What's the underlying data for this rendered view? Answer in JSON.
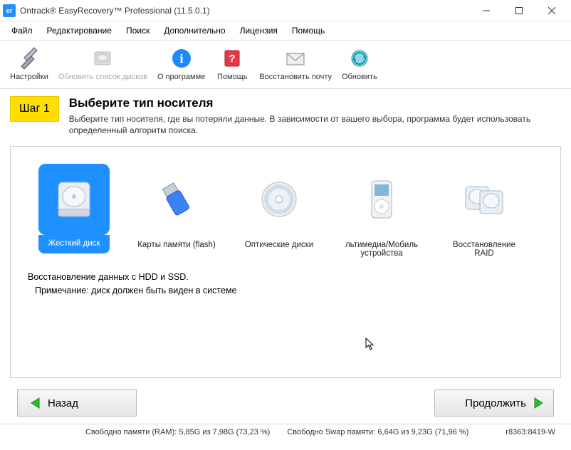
{
  "window": {
    "app_icon_text": "er",
    "title": "Ontrack® EasyRecovery™ Professional (11.5.0.1)"
  },
  "menu": {
    "items": [
      "Файл",
      "Редактирование",
      "Поиск",
      "Дополнительно",
      "Лицензия",
      "Помощь"
    ]
  },
  "toolbar": {
    "settings": "Настройки",
    "refresh_disks": "Обновить список дисков",
    "about": "О программе",
    "help": "Помощь",
    "restore_mail": "Восстановить почту",
    "update": "Обновить"
  },
  "step": {
    "badge": "Шаг 1",
    "title": "Выберите тип носителя",
    "subtitle": "Выберите тип носителя, где вы потеряли данные. В зависимости от вашего выбора, программа будет использовать определенный алгоритм поиска."
  },
  "media": {
    "hdd": "Жесткий диск",
    "flash": "Карты памяти (flash)",
    "optical": "Оптические диски",
    "multimedia": "льтимедиа/Мобиль устройства",
    "raid": "Восстановление RAID"
  },
  "description": {
    "line1": "Восстановление данных с HDD и SSD.",
    "line2": "Примечание: диск должен быть виден в системе"
  },
  "nav": {
    "back": "Назад",
    "continue": "Продолжить"
  },
  "status": {
    "ram": "Свободно памяти (RAM): 5,85G из 7,98G (73,23 %)",
    "swap": "Свободно Swap памяти: 6,64G из 9,23G (71,96 %)",
    "rev": "r8363:8419-W"
  }
}
